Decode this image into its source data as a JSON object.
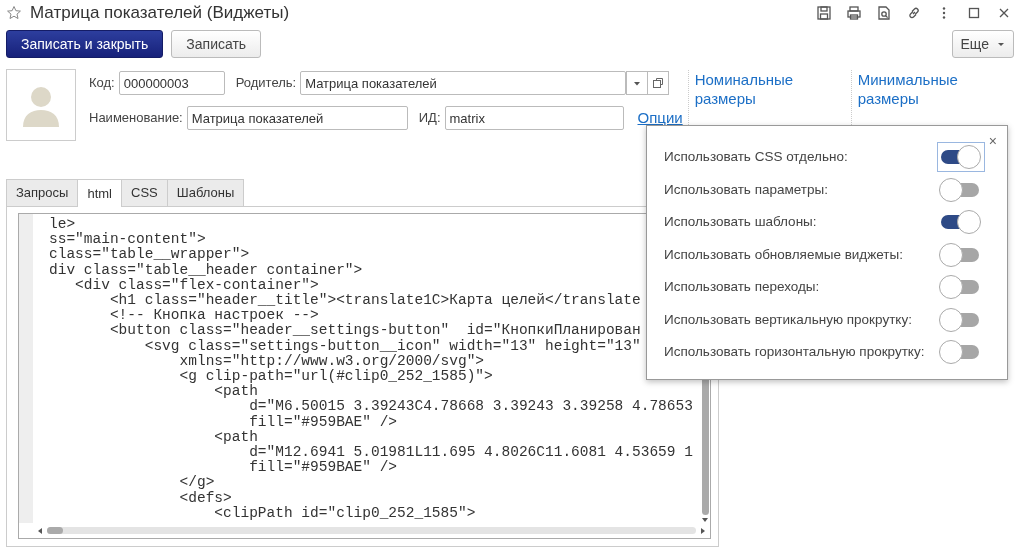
{
  "window": {
    "title": "Матрица показателей (Виджеты)"
  },
  "toolbar": {
    "buttons": [
      {
        "label": "Записать и закрыть",
        "kind": "primary"
      },
      {
        "label": "Записать",
        "kind": "default"
      }
    ],
    "more": "Еще"
  },
  "form": {
    "code": {
      "label": "Код:",
      "value": "000000003"
    },
    "parent": {
      "label": "Родитель:",
      "value": "Матрица показателей"
    },
    "name": {
      "label": "Наименование:",
      "value": "Матрица показателей"
    },
    "id": {
      "label": "ИД:",
      "value": "matrix"
    },
    "options_link": "Опции"
  },
  "size_groups": [
    {
      "title": "Номинальные размеры"
    },
    {
      "title": "Минимальные размеры"
    }
  ],
  "tabs": [
    {
      "label": "Запросы",
      "selected": false
    },
    {
      "label": "html",
      "selected": true
    },
    {
      "label": "CSS",
      "selected": false
    },
    {
      "label": "Шаблоны",
      "selected": false
    }
  ],
  "editor": {
    "lines": [
      "le>",
      "ss=\"main-content\">",
      "class=\"table__wrapper\">",
      "div class=\"table__header container\">",
      "   <div class=\"flex-container\">",
      "       <h1 class=\"header__title\"><translate1C>Карта целей</translate",
      "       <!-- Кнопка настроек -->",
      "       <button class=\"header__settings-button\"  id=\"КнопкиПланирован",
      "           <svg class=\"settings-button__icon\" width=\"13\" height=\"13\"",
      "               xmlns=\"http://www.w3.org/2000/svg\">",
      "               <g clip-path=\"url(#clip0_252_1585)\">",
      "                   <path",
      "                       d=\"M6.50015 3.39243C4.78668 3.39243 3.39258 4.78653",
      "                       fill=\"#959BAE\" />",
      "                   <path",
      "                       d=\"M12.6941 5.01981L11.695 4.8026C11.6081 4.53659 1",
      "                       fill=\"#959BAE\" />",
      "               </g>",
      "               <defs>",
      "                   <clipPath id=\"clip0_252_1585\">"
    ]
  },
  "options_popup": {
    "close": "×",
    "items": [
      {
        "label": "Использовать CSS отдельно:",
        "on": true,
        "focused": true
      },
      {
        "label": "Использовать параметры:",
        "on": false,
        "focused": false
      },
      {
        "label": "Использовать шаблоны:",
        "on": true,
        "focused": false
      },
      {
        "label": "Использовать обновляемые виджеты:",
        "on": false,
        "focused": false
      },
      {
        "label": "Использовать переходы:",
        "on": false,
        "focused": false
      },
      {
        "label": "Использовать вертикальную прокрутку:",
        "on": false,
        "focused": false
      },
      {
        "label": "Использовать горизонтальную прокрутку:",
        "on": false,
        "focused": false
      }
    ]
  }
}
